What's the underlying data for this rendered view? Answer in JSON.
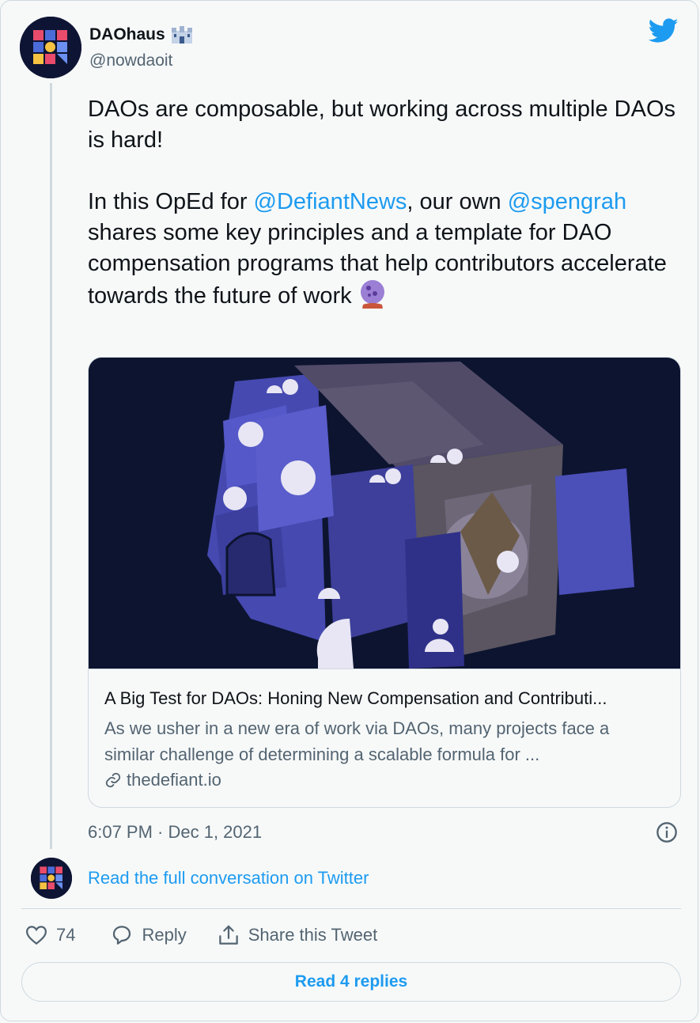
{
  "author": {
    "display_name": "DAOhaus",
    "name_emoji": "🏰",
    "handle": "@nowdaoit"
  },
  "tweet": {
    "text_line1": "DAOs are composable, but working across multiple DAOs is hard!",
    "text_p2_a": "In this OpEd for ",
    "mention1": "@DefiantNews",
    "text_p2_b": ", our own ",
    "mention2": "@spengrah",
    "text_p2_c": " shares some key principles and a template for DAO compensation programs that help contributors accelerate towards the future of work ",
    "emoji_end": "crystal-ball"
  },
  "link_card": {
    "title": "A Big Test for DAOs: Honing New Compensation and Contributi...",
    "description": "As we usher in a new era of work via DAOs, many projects face a similar challenge of determining a scalable formula for ...",
    "domain": "thedefiant.io"
  },
  "timestamp": "6:07 PM · Dec 1, 2021",
  "read_conversation": "Read the full conversation on Twitter",
  "actions": {
    "like_count": "74",
    "reply_label": "Reply",
    "share_label": "Share this Tweet"
  },
  "read_replies": "Read 4 replies",
  "colors": {
    "accent": "#1d9bf0",
    "text": "#0f1419",
    "muted": "#536471",
    "border": "#cfd9de",
    "background": "#f7f9f9"
  }
}
